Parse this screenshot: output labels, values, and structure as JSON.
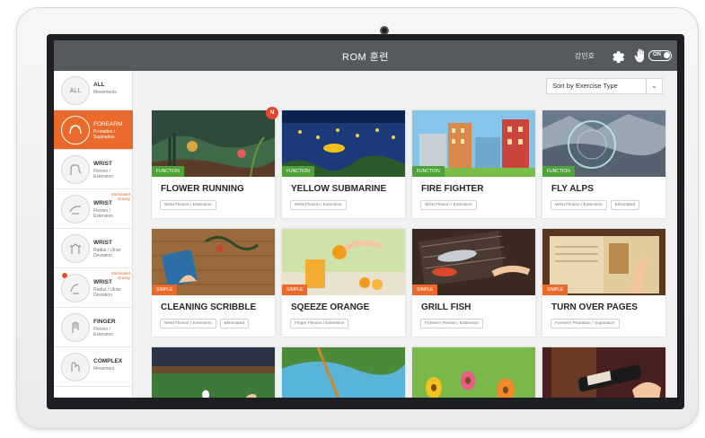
{
  "topbar": {
    "title": "ROM 훈련",
    "user": "강민호",
    "toggle": "ON"
  },
  "sidebar": {
    "items": [
      {
        "icon_text": "ALL",
        "label": "ALL",
        "sub": "Movements",
        "corner": "",
        "icon": "all-circle-icon"
      },
      {
        "icon_text": "",
        "label": "FOREARM",
        "sub": "Pronation / Supination",
        "corner": "",
        "icon": "forearm-icon"
      },
      {
        "icon_text": "",
        "label": "WRIST",
        "sub": "Flexion / Extension",
        "corner": "",
        "icon": "wrist-flex-icon"
      },
      {
        "icon_text": "",
        "label": "WRIST",
        "sub": "Flexion / Extension",
        "corner": "Eliminated Gravity",
        "icon": "wrist-flex-gravity-icon"
      },
      {
        "icon_text": "",
        "label": "WRIST",
        "sub": "Radial / Ulnar Deviation",
        "corner": "",
        "icon": "wrist-deviation-icon"
      },
      {
        "icon_text": "",
        "label": "WRIST",
        "sub": "Radial / Ulnar Deviation",
        "corner": "Eliminated Gravity",
        "icon": "wrist-deviation-gravity-icon"
      },
      {
        "icon_text": "",
        "label": "FINGER",
        "sub": "Flexion / Extension",
        "corner": "",
        "icon": "finger-icon"
      },
      {
        "icon_text": "",
        "label": "COMPLEX",
        "sub": "Movement",
        "corner": "",
        "icon": "complex-icon"
      }
    ]
  },
  "sort": {
    "label": "Sort by Exercise Type"
  },
  "cards": [
    {
      "name": "FLOWER RUNNING",
      "tag": "FUNCTION",
      "chips": [
        "Wrist Flexion / Extension"
      ],
      "new": "N"
    },
    {
      "name": "YELLOW SUBMARINE",
      "tag": "FUNCTION",
      "chips": [
        "Wrist Flexion / Extension"
      ]
    },
    {
      "name": "FIRE FIGHTER",
      "tag": "FUNCTION",
      "chips": [
        "Wrist Flexion / Extension"
      ]
    },
    {
      "name": "FLY ALPS",
      "tag": "FUNCTION",
      "chips": [
        "Wrist Flexion / Extension",
        "Eliminated"
      ]
    },
    {
      "name": "CLEANING SCRIBBLE",
      "tag": "SIMPLE",
      "chips": [
        "Wrist Flexion / Extension",
        "Eliminated"
      ]
    },
    {
      "name": "SQEEZE ORANGE",
      "tag": "SIMPLE",
      "chips": [
        "Finger Flexion / Extension"
      ]
    },
    {
      "name": "GRILL FISH",
      "tag": "SIMPLE",
      "chips": [
        "Forearm Flexion / Extension"
      ]
    },
    {
      "name": "TURN OVER PAGES",
      "tag": "SIMPLE",
      "chips": [
        "Forearm Pronation / Supination"
      ]
    }
  ],
  "colors": {
    "accent": "#ea6a2b",
    "function_tag": "#4ea23a",
    "topbar": "#565a5f"
  }
}
